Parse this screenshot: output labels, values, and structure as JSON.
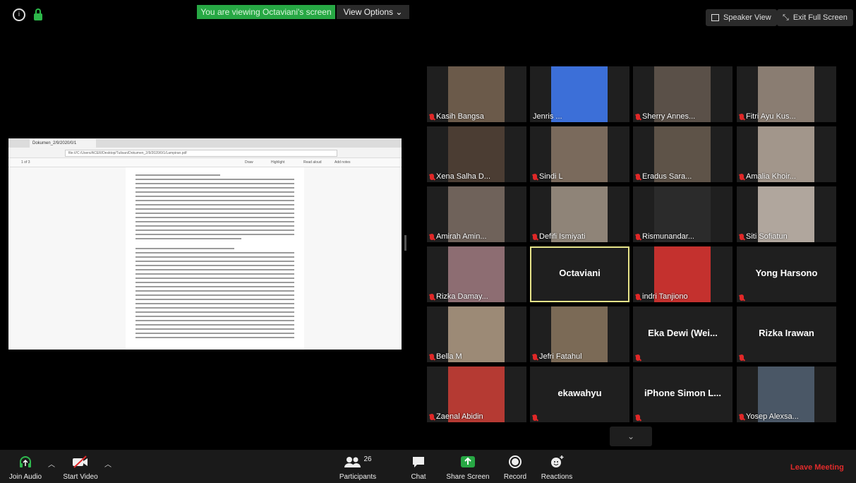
{
  "top": {
    "viewing_banner": "You are viewing Octaviani's screen",
    "view_options": "View Options ⌄",
    "speaker_view": "Speaker View",
    "exit_full_screen": "Exit Full Screen"
  },
  "shared_doc": {
    "tab_title": "Dokumen_2/9/2020/0/1",
    "address": "file:///C:/Users/ACER/Desktop/Tulisan/Dokumen_2/9/2020/0/1/Lampiran.pdf",
    "page_number": "1 of 3",
    "tool_draw": "Draw",
    "tool_highlight": "Highlight",
    "tool_read_aloud": "Read aloud",
    "tool_add_notes": "Add notes"
  },
  "participants": [
    {
      "name": "Kasih Bangsa",
      "muted": true,
      "kind": "video"
    },
    {
      "name": "Jenris ...",
      "muted": false,
      "kind": "video"
    },
    {
      "name": "Sherry Annes...",
      "muted": true,
      "kind": "video"
    },
    {
      "name": "Fitri Ayu Kus...",
      "muted": true,
      "kind": "video"
    },
    {
      "name": "Xena Salha D...",
      "muted": true,
      "kind": "video"
    },
    {
      "name": "Sindi L",
      "muted": true,
      "kind": "video"
    },
    {
      "name": "Eradus Sara...",
      "muted": true,
      "kind": "video"
    },
    {
      "name": "Amalia Khoir...",
      "muted": true,
      "kind": "video"
    },
    {
      "name": "Amirah Amin...",
      "muted": true,
      "kind": "video"
    },
    {
      "name": "Defifi Ismiyati",
      "muted": true,
      "kind": "video"
    },
    {
      "name": "Rismunandar...",
      "muted": true,
      "kind": "video"
    },
    {
      "name": "Siti Sofiatun",
      "muted": true,
      "kind": "video"
    },
    {
      "name": "Rizka Damay...",
      "muted": true,
      "kind": "video"
    },
    {
      "name": "Octaviani",
      "muted": false,
      "kind": "name"
    },
    {
      "name": "indri Tanjiono",
      "muted": true,
      "kind": "video"
    },
    {
      "name": "Yong Harsono",
      "muted": true,
      "kind": "name"
    },
    {
      "name": "Bella M",
      "muted": true,
      "kind": "video"
    },
    {
      "name": "Jefri Fatahul",
      "muted": true,
      "kind": "video"
    },
    {
      "name": "Eka Dewi (Wei...",
      "muted": true,
      "kind": "name"
    },
    {
      "name": "Rizka Irawan",
      "muted": true,
      "kind": "name"
    },
    {
      "name": "Zaenal Abidin",
      "muted": true,
      "kind": "video"
    },
    {
      "name": "ekawahyu",
      "muted": true,
      "kind": "name"
    },
    {
      "name": "iPhone Simon L...",
      "muted": true,
      "kind": "name"
    },
    {
      "name": "Yosep Alexsa...",
      "muted": true,
      "kind": "video"
    }
  ],
  "toolbar": {
    "join_audio": "Join Audio",
    "start_video": "Start Video",
    "participants_label": "Participants",
    "participants_count": "26",
    "chat": "Chat",
    "share_screen": "Share Screen",
    "record": "Record",
    "reactions": "Reactions",
    "leave": "Leave Meeting"
  },
  "colors": {
    "green": "#27a844",
    "active_border": "#e7e48a",
    "mute_red": "#e02828",
    "leave_red": "#e02b2b"
  }
}
